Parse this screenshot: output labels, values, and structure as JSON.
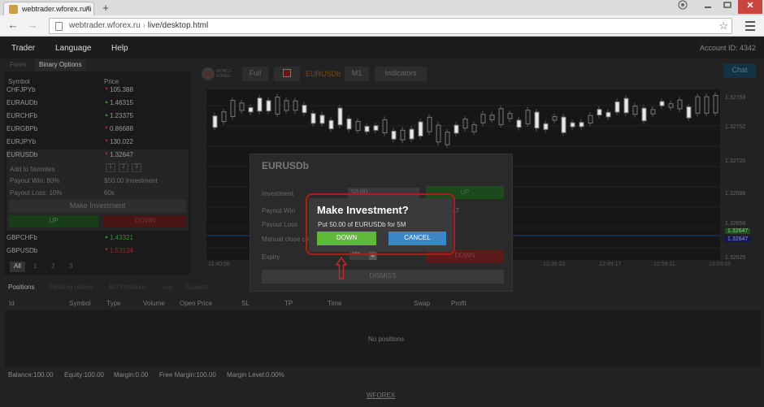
{
  "browser": {
    "tab_title": "webtrader.wforex.ru/li",
    "tab_close": "×",
    "new_tab": "+",
    "back": "←",
    "forward": "→",
    "url_host": "webtrader.wforex.ru",
    "url_sep": " › ",
    "url_path": "live/desktop.html",
    "star": "☆"
  },
  "topnav": {
    "items": [
      "Trader",
      "Language",
      "Help"
    ],
    "account": "Account ID: 4342"
  },
  "left_panel": {
    "tabs": [
      "Forex",
      "Binary Options"
    ],
    "col_symbol": "Symbol",
    "col_price": "Price",
    "symbols": [
      {
        "name": "CHFJPYb",
        "dir": "down",
        "arrow": "▼",
        "price": "105.388"
      },
      {
        "name": "EURAUDb",
        "dir": "up",
        "arrow": "▲",
        "price": "1.46315"
      },
      {
        "name": "EURCHFb",
        "dir": "up",
        "arrow": "▲",
        "price": "1.23375"
      },
      {
        "name": "EURGBPb",
        "dir": "down",
        "arrow": "▼",
        "price": "0.86688"
      },
      {
        "name": "EURJPYb",
        "dir": "down",
        "arrow": "▼",
        "price": "130.022"
      },
      {
        "name": "EURUSDb",
        "dir": "down",
        "arrow": "▼",
        "price": "1.32647"
      }
    ],
    "selected": {
      "add_favorites": "Add to favorites",
      "fav_boxes": [
        "1",
        "2",
        "3"
      ],
      "payout_win_label": "Payout Win: 80%",
      "investment_label": "$50.00 Investment",
      "payout_loss_label": "Payout Loss: 10%",
      "duration": "60s",
      "make_investment": "Make Investment",
      "up": "UP",
      "down": "DOWN"
    },
    "more_symbols": [
      {
        "name": "GBPCHFb",
        "dir": "up",
        "arrow": "▲",
        "price": "1.43321"
      },
      {
        "name": "GBPUSDb",
        "dir": "down",
        "arrow": "▼",
        "price": "1.53134"
      }
    ],
    "pager": [
      "All",
      "1",
      "2",
      "3"
    ]
  },
  "chart_toolbar": {
    "logo_text": "WORLD FOREX",
    "full": "Full",
    "symbol": "EURUSDb",
    "timeframe": "M1",
    "indicators": "Indicators",
    "chat": "Chat"
  },
  "chart": {
    "price_labels": [
      "1.32763",
      "1.32752",
      "1.32720",
      "1.32688",
      "1.32656",
      "1.32647",
      "1.32647",
      "1.32625"
    ],
    "time_labels": [
      "11:40:58",
      "12:39:23",
      "12:49:17",
      "12:59:11",
      "13:09:05"
    ]
  },
  "bottom": {
    "tabs": [
      "Positions",
      "Pending orders",
      "BO Positions",
      "Log",
      "Support"
    ],
    "columns": [
      "Id",
      "Symbol",
      "Type",
      "Volume",
      "Open Price",
      "SL",
      "TP",
      "Time",
      "Swap",
      "Profit"
    ],
    "no_positions": "No positions",
    "stats": [
      "Balance:100.00",
      "Equity:100.00",
      "Margin:0.00",
      "Free Margin:100.00",
      "Margin Level:0.00%"
    ],
    "brand": "WFOREX"
  },
  "dialog": {
    "title": "EURUSDb",
    "investment_label": "Investment",
    "investment_value": "50.00",
    "payout_win_label": "Payout Win",
    "payout_win_value": "47",
    "payout_loss_label": "Payout Loss",
    "manual_close_label": "Manual close co",
    "expiry_label": "Expiry",
    "expiry_value": "5M",
    "up": "UP",
    "down": "DOWN",
    "dismiss": "DISMISS"
  },
  "confirm": {
    "title": "Make Investment?",
    "message": "Put 50.00 of EURUSDb for 5M",
    "down": "DOWN",
    "cancel": "CANCEL"
  }
}
